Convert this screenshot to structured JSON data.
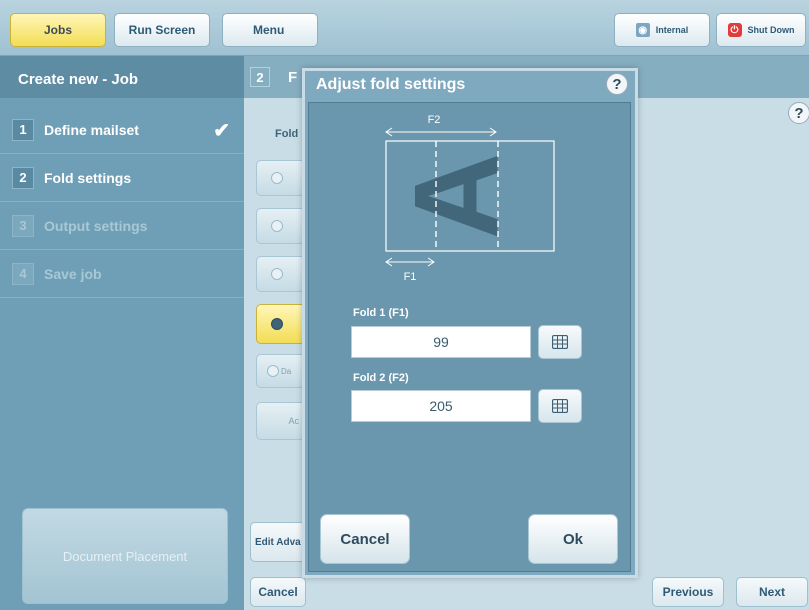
{
  "topbar": {
    "tabs": [
      {
        "label": "Jobs"
      },
      {
        "label": "Run Screen"
      },
      {
        "label": "Menu"
      }
    ],
    "internal_label": "Internal",
    "shutdown_label": "Shut Down"
  },
  "sidebar": {
    "title": "Create new - Job",
    "items": [
      {
        "num": "1",
        "label": "Define mailset",
        "state": "done"
      },
      {
        "num": "2",
        "label": "Fold settings",
        "state": "active"
      },
      {
        "num": "3",
        "label": "Output settings",
        "state": "disabled"
      },
      {
        "num": "4",
        "label": "Save job",
        "state": "disabled"
      }
    ],
    "document_placement_label": "Document Placement"
  },
  "main": {
    "step_num": "2",
    "title_fragment": "F",
    "fold_label_fragment": "Fold",
    "option_fragment_da": "Da",
    "adv_fragment": "Ac",
    "edit_adv_label": "Edit Adva",
    "cancel_label": "Cancel",
    "previous_label": "Previous",
    "next_label": "Next",
    "help_glyph": "?"
  },
  "dialog": {
    "title": "Adjust fold settings",
    "help_glyph": "?",
    "diagram": {
      "letter": "A",
      "f1_label": "F1",
      "f2_label": "F2"
    },
    "fold1": {
      "label": "Fold 1 (F1)",
      "value": "99"
    },
    "fold2": {
      "label": "Fold 2 (F2)",
      "value": "205"
    },
    "cancel_label": "Cancel",
    "ok_label": "Ok"
  },
  "colors": {
    "active_tab": "#f3dd55",
    "sidebar": "#6f9fb6",
    "dialog": "#6a97ad",
    "shutdown_icon": "#e23b3b"
  }
}
